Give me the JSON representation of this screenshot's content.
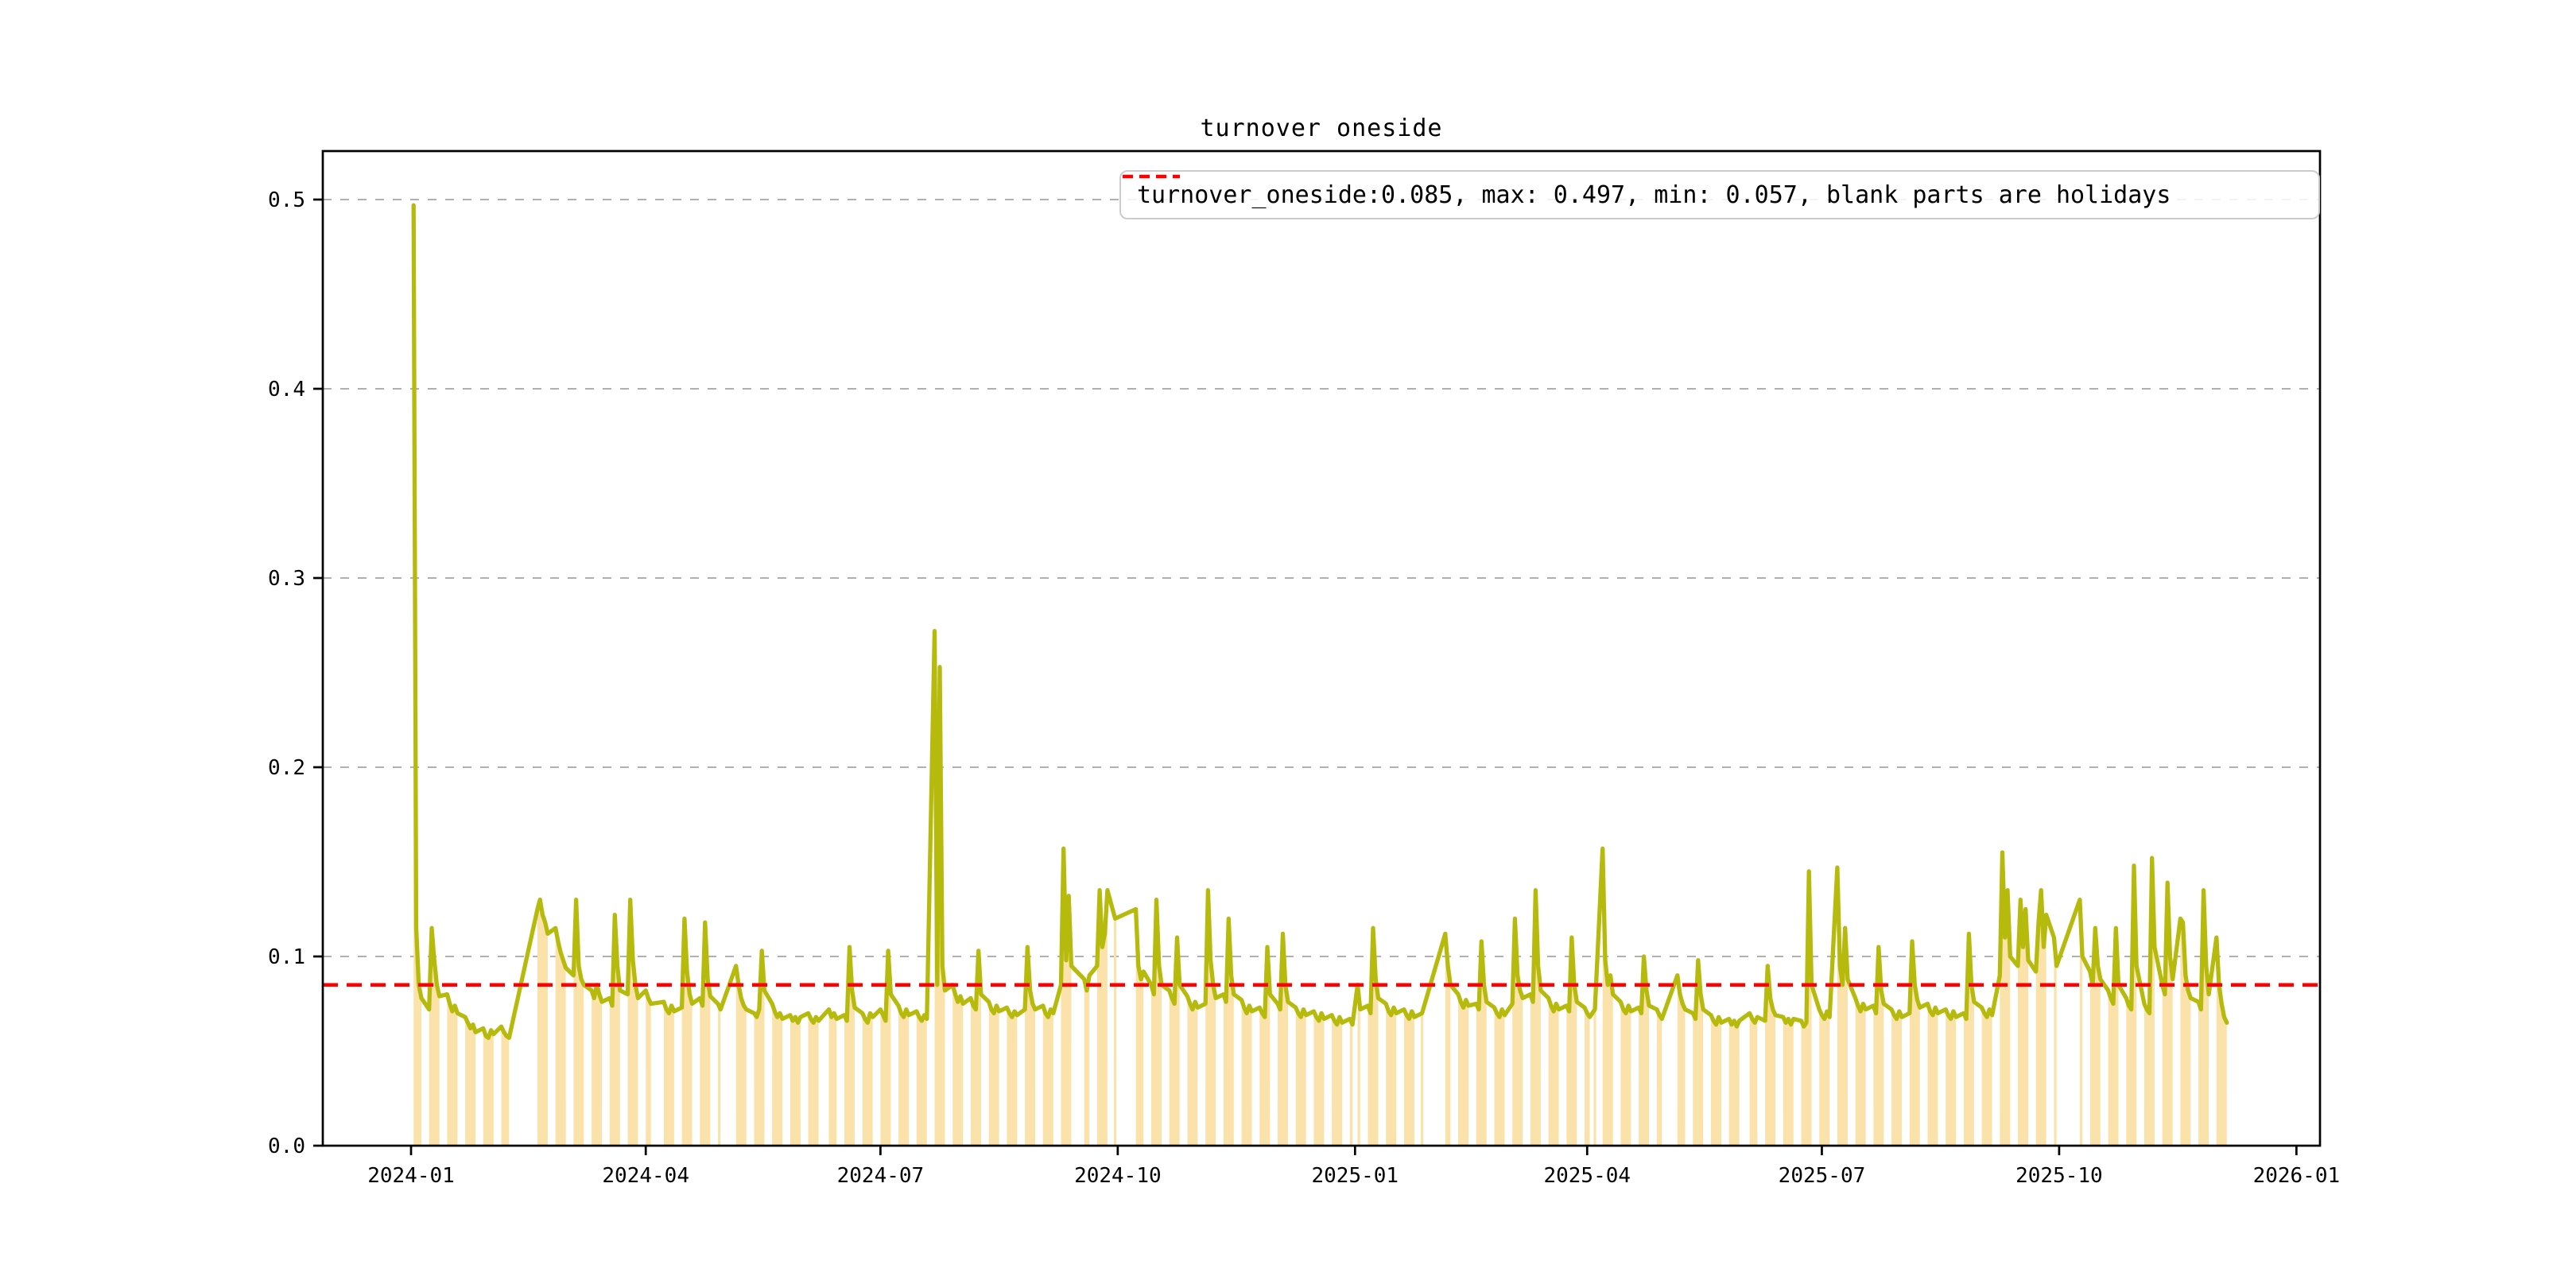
{
  "chart_data": {
    "type": "line",
    "title": "turnover oneside",
    "legend": {
      "label": "turnover_oneside:0.085, max: 0.497, min: 0.057, blank parts are holidays",
      "marker": "red-dashed-line"
    },
    "stats": {
      "mean": 0.085,
      "max": 0.497,
      "min": 0.057
    },
    "mean_line": {
      "value": 0.085,
      "style": "dashed"
    },
    "grid": "horizontal-dashed",
    "legend_position": "top-right",
    "ylim": [
      0,
      0.525
    ],
    "yticks": [
      {
        "label": "0.0",
        "value": 0.0
      },
      {
        "label": "0.1",
        "value": 0.1
      },
      {
        "label": "0.2",
        "value": 0.2
      },
      {
        "label": "0.3",
        "value": 0.3
      },
      {
        "label": "0.4",
        "value": 0.4
      },
      {
        "label": "0.5",
        "value": 0.5
      }
    ],
    "xticks": [
      {
        "label": "2024-01",
        "day": 0
      },
      {
        "label": "2024-04",
        "day": 91
      },
      {
        "label": "2024-07",
        "day": 182
      },
      {
        "label": "2024-10",
        "day": 274
      },
      {
        "label": "2025-01",
        "day": 366
      },
      {
        "label": "2025-04",
        "day": 456
      },
      {
        "label": "2025-07",
        "day": 547
      },
      {
        "label": "2025-10",
        "day": 639
      },
      {
        "label": "2026-01",
        "day": 731
      }
    ],
    "colors": {
      "line": "#b6ba0d",
      "fill": "#fbe2ab",
      "grid": "#b0b0b0",
      "mean": "#ff0000",
      "spine": "#000000",
      "text": "#000000",
      "legend_border": "#cccccc"
    },
    "series_name": "turnover_oneside",
    "holidays_note": "blank parts are holidays",
    "start_monday": "2024-01-01",
    "weekday_values_by_week": [
      [
        null,
        0.497,
        0.115,
        0.085,
        0.078
      ],
      [
        0.072,
        0.115,
        0.098,
        0.085,
        0.079
      ],
      [
        0.08,
        0.075,
        0.071,
        0.074,
        0.07
      ],
      [
        0.068,
        0.065,
        0.062,
        0.064,
        0.06
      ],
      [
        0.062,
        0.058,
        0.057,
        0.061,
        0.059
      ],
      [
        0.063,
        0.06,
        0.058,
        0.057,
        null
      ],
      [
        null,
        null,
        null,
        null,
        null
      ],
      [
        0.125,
        0.13,
        0.122,
        0.118,
        0.112
      ],
      [
        0.115,
        0.108,
        0.102,
        0.098,
        0.094
      ],
      [
        0.09,
        0.13,
        0.095,
        0.088,
        0.085
      ],
      [
        0.082,
        0.078,
        0.085,
        0.08,
        0.076
      ],
      [
        0.078,
        0.074,
        0.122,
        0.095,
        0.082
      ],
      [
        0.08,
        0.13,
        0.098,
        0.085,
        0.078
      ],
      [
        0.082,
        0.078,
        0.075,
        null,
        null
      ],
      [
        0.076,
        0.072,
        0.07,
        0.074,
        0.071
      ],
      [
        0.073,
        0.12,
        0.092,
        0.08,
        0.075
      ],
      [
        0.078,
        0.074,
        0.118,
        0.088,
        0.079
      ],
      [
        0.075,
        0.072,
        null,
        null,
        null
      ],
      [
        0.095,
        0.085,
        0.078,
        0.074,
        0.072
      ],
      [
        0.07,
        0.068,
        0.072,
        0.103,
        0.082
      ],
      [
        0.075,
        0.071,
        0.068,
        0.07,
        0.067
      ],
      [
        0.069,
        0.066,
        0.068,
        0.065,
        0.068
      ],
      [
        0.07,
        0.067,
        0.065,
        0.068,
        0.066
      ],
      [
        null,
        0.072,
        0.068,
        0.07,
        0.067
      ],
      [
        0.069,
        0.066,
        0.105,
        0.082,
        0.073
      ],
      [
        0.07,
        0.067,
        0.065,
        0.07,
        0.068
      ],
      [
        0.072,
        0.069,
        0.066,
        0.103,
        0.08
      ],
      [
        0.074,
        0.07,
        0.068,
        0.072,
        0.069
      ],
      [
        0.071,
        0.068,
        0.066,
        0.069,
        0.067
      ],
      [
        0.272,
        0.085,
        0.253,
        0.095,
        0.082
      ],
      [
        0.085,
        0.08,
        0.076,
        0.079,
        0.075
      ],
      [
        0.078,
        0.074,
        0.072,
        0.103,
        0.08
      ],
      [
        0.076,
        0.072,
        0.07,
        0.074,
        0.071
      ],
      [
        0.073,
        0.07,
        0.068,
        0.071,
        0.069
      ],
      [
        0.072,
        0.105,
        0.082,
        0.075,
        0.072
      ],
      [
        0.074,
        0.07,
        0.068,
        0.072,
        0.07
      ],
      [
        0.085,
        0.157,
        0.098,
        0.132,
        0.095
      ],
      [
        null,
        null,
        0.088,
        0.082,
        0.09
      ],
      [
        0.095,
        0.135,
        0.105,
        0.112,
        0.135
      ],
      [
        0.12,
        null,
        null,
        null,
        null
      ],
      [
        null,
        0.125,
        0.095,
        0.088,
        0.092
      ],
      [
        0.085,
        0.08,
        0.13,
        0.095,
        0.085
      ],
      [
        0.082,
        0.078,
        0.075,
        0.11,
        0.085
      ],
      [
        0.079,
        0.075,
        0.072,
        0.076,
        0.073
      ],
      [
        0.075,
        0.135,
        0.098,
        0.085,
        0.078
      ],
      [
        0.08,
        0.076,
        0.12,
        0.09,
        0.08
      ],
      [
        0.077,
        0.073,
        0.07,
        0.074,
        0.071
      ],
      [
        0.073,
        0.07,
        0.068,
        0.105,
        0.08
      ],
      [
        0.075,
        0.072,
        0.112,
        0.085,
        0.076
      ],
      [
        0.073,
        0.07,
        0.068,
        0.072,
        0.069
      ],
      [
        0.071,
        0.068,
        0.066,
        0.07,
        0.067
      ],
      [
        0.069,
        0.066,
        0.064,
        0.068,
        0.065
      ],
      [
        0.067,
        0.064,
        null,
        0.085,
        0.072
      ],
      [
        0.074,
        0.07,
        0.115,
        0.088,
        0.078
      ],
      [
        0.075,
        0.071,
        0.069,
        0.073,
        0.07
      ],
      [
        0.072,
        0.069,
        0.067,
        0.071,
        0.068
      ],
      [
        0.07,
        null,
        null,
        null,
        null
      ],
      [
        null,
        null,
        0.112,
        0.095,
        0.085
      ],
      [
        0.08,
        0.076,
        0.073,
        0.077,
        0.074
      ],
      [
        0.075,
        0.072,
        0.108,
        0.085,
        0.076
      ],
      [
        0.073,
        0.07,
        0.068,
        0.072,
        0.069
      ],
      [
        0.075,
        0.12,
        0.09,
        0.082,
        0.078
      ],
      [
        0.08,
        0.076,
        0.135,
        0.095,
        0.082
      ],
      [
        0.078,
        0.074,
        0.071,
        0.075,
        0.072
      ],
      [
        0.074,
        0.071,
        0.11,
        0.085,
        0.076
      ],
      [
        0.073,
        0.07,
        0.068,
        null,
        0.072
      ],
      [
        0.157,
        0.098,
        0.085,
        0.09,
        0.08
      ],
      [
        0.076,
        0.072,
        0.07,
        0.074,
        0.071
      ],
      [
        0.073,
        0.07,
        0.1,
        0.082,
        0.074
      ],
      [
        0.072,
        0.069,
        0.067,
        null,
        null
      ],
      [
        null,
        0.09,
        0.08,
        0.075,
        0.072
      ],
      [
        0.07,
        0.067,
        0.098,
        0.08,
        0.072
      ],
      [
        0.069,
        0.066,
        0.064,
        0.068,
        0.065
      ],
      [
        0.067,
        0.064,
        0.066,
        0.063,
        0.066
      ],
      [
        null,
        0.07,
        0.067,
        0.065,
        0.068
      ],
      [
        0.066,
        0.095,
        0.078,
        0.072,
        0.069
      ],
      [
        0.068,
        0.065,
        0.067,
        0.064,
        0.067
      ],
      [
        0.066,
        0.063,
        0.065,
        0.145,
        0.085
      ],
      [
        0.072,
        0.069,
        0.067,
        0.071,
        0.068
      ],
      [
        0.147,
        0.095,
        0.085,
        0.115,
        0.088
      ],
      [
        0.078,
        0.074,
        0.071,
        0.075,
        0.072
      ],
      [
        0.074,
        0.07,
        0.105,
        0.082,
        0.075
      ],
      [
        0.072,
        0.069,
        0.067,
        0.071,
        0.068
      ],
      [
        0.07,
        0.108,
        0.085,
        0.077,
        0.073
      ],
      [
        0.075,
        0.071,
        0.069,
        0.073,
        0.07
      ],
      [
        0.072,
        0.069,
        0.067,
        0.071,
        0.068
      ],
      [
        0.07,
        0.067,
        0.112,
        0.085,
        0.076
      ],
      [
        0.073,
        0.07,
        0.068,
        0.072,
        0.069
      ],
      [
        0.09,
        0.155,
        0.11,
        0.135,
        0.1
      ],
      [
        0.095,
        0.13,
        0.105,
        0.125,
        0.098
      ],
      [
        0.092,
        0.118,
        0.135,
        0.105,
        0.122
      ],
      [
        0.11,
        0.095,
        null,
        null,
        null
      ],
      [
        null,
        null,
        null,
        0.13,
        0.1
      ],
      [
        0.092,
        0.085,
        0.115,
        0.095,
        0.088
      ],
      [
        0.082,
        0.078,
        0.075,
        0.115,
        0.085
      ],
      [
        0.078,
        0.074,
        0.072,
        0.148,
        0.095
      ],
      [
        0.075,
        0.072,
        0.07,
        0.152,
        0.105
      ],
      [
        0.085,
        0.08,
        0.139,
        0.1,
        0.088
      ],
      [
        0.12,
        0.118,
        0.09,
        0.082,
        0.078
      ],
      [
        0.076,
        0.072,
        0.135,
        0.095,
        0.08
      ],
      [
        0.11,
        0.085,
        0.075,
        0.068,
        0.065
      ]
    ]
  }
}
